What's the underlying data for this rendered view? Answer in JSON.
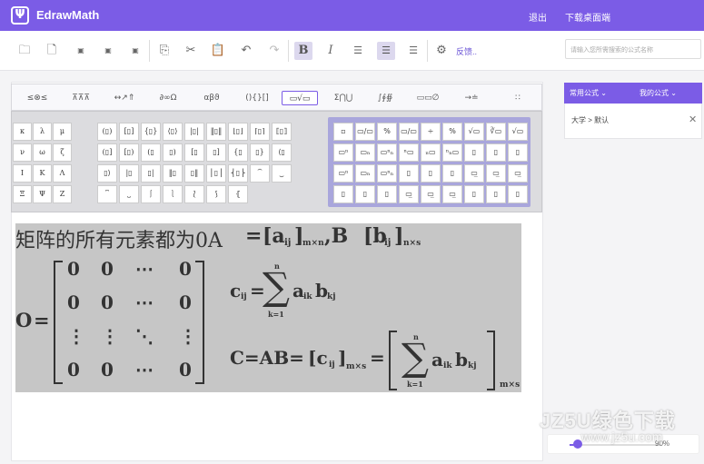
{
  "app": {
    "name": "EdrawMath",
    "logo": "Ψ",
    "logout": "退出",
    "download_desktop": "下载桌面端"
  },
  "toolbar": {
    "icons": [
      "open-folder-icon",
      "new-file-icon",
      "export-png-icon",
      "export-jpg-icon",
      "export-svg-icon",
      "copy-icon",
      "cut-icon",
      "paste-icon",
      "undo-icon",
      "redo-icon",
      "bold-icon",
      "italic-icon",
      "align-left-icon",
      "align-center-icon",
      "align-right-icon",
      "settings-icon"
    ],
    "bold": "B",
    "italic": "I",
    "feedback": "反馈.."
  },
  "search": {
    "placeholder": "请输入您所需搜索的公式名称"
  },
  "categories": [
    "≤⊗≤",
    "⊼⊼⊼",
    "↔↗⇑",
    "∂∞Ω",
    "αβϑ",
    "(){}[]",
    "▭√▭",
    "Σ⋂⋃",
    "∫∮∯",
    "▭▭∅",
    "→≐",
    "∷"
  ],
  "palette": {
    "greek": [
      "κ",
      "λ",
      "μ",
      "ν",
      "ω",
      "ζ",
      "Ι",
      "Κ",
      "Λ",
      "Ξ",
      "Ψ",
      "Ζ"
    ],
    "brackets": [
      "(▯)",
      "[▯]",
      "{▯}",
      "⟨▯⟩",
      "|▯|",
      "‖▯‖",
      "⌊▯⌋",
      "⌈▯⌉",
      "⟦▯⟧",
      "(▯]",
      "[▯)",
      "(▯",
      "▯)",
      "[▯",
      "▯]",
      "{▯",
      "▯}",
      "⟨▯",
      "▯⟩",
      "|▯",
      "▯|",
      "‖▯",
      "▯‖",
      "⎪▯⎪",
      "⎨▯⎬",
      "⏞",
      "⏟",
      "⎴",
      "⎵",
      "⎰",
      "⎱",
      "⟅",
      "⟆",
      "⦃"
    ],
    "templates": [
      "▫",
      "▭/▭",
      "%",
      "▭/▭",
      "÷",
      "%",
      "√▭",
      "∛▭",
      "√▭",
      "▭ⁿ",
      "▭ₙ",
      "▭ⁿₙ",
      "ⁿ▭",
      "ₙ▭",
      "ⁿₙ▭",
      "▯",
      "▯",
      "▯",
      "▭ⁿ",
      "▭ₙ",
      "▭ⁿₙ",
      "▯",
      "▯",
      "▯",
      "▭̲",
      "▭̲",
      "▭̲",
      "▯",
      "▯",
      "▯",
      "▭̲",
      "▭̲",
      "▭̲",
      "▯",
      "▯",
      "▯"
    ]
  },
  "formula": {
    "line1": {
      "text": "矩阵的所有元素都为0A",
      "eq": "=",
      "a": "[a",
      "a_sub": "ij",
      "close": "]",
      "a_dim": "m×n",
      "comma": ",B",
      "b": "[b",
      "b_dim": "n×s"
    },
    "zero": {
      "label": "O",
      "eq": "=",
      "rows": [
        [
          "0",
          "0",
          "⋯",
          "0"
        ],
        [
          "0",
          "0",
          "⋯",
          "0"
        ],
        [
          "⋮",
          "⋮",
          "⋱",
          "⋮"
        ],
        [
          "0",
          "0",
          "⋯",
          "0"
        ]
      ]
    },
    "cij": {
      "c": "c",
      "sub": "ij",
      "eq": "=",
      "sigma": "∑",
      "upper": "n",
      "lower": "k=1",
      "a": "a",
      "a_sub": "ik",
      "b": "b",
      "b_sub": "kj"
    },
    "product": {
      "lhs": "C=AB=",
      "c": "[c",
      "c_sub": "ij",
      "close": "]",
      "dim": "m×s",
      "eq": "=",
      "sigma": "∑",
      "upper": "n",
      "lower": "k=1",
      "a": "a",
      "a_sub": "ik",
      "b": "b",
      "b_sub": "kj",
      "outer_dim": "m×s"
    }
  },
  "right_panel": {
    "tab_common": "常用公式",
    "tab_mine": "我的公式",
    "path": "大学 > 默认"
  },
  "zoom": {
    "value": 0.9,
    "label": "90%"
  },
  "watermark": {
    "line1": "JZ5U绿色下载",
    "line2": "www.jz5u.com"
  }
}
